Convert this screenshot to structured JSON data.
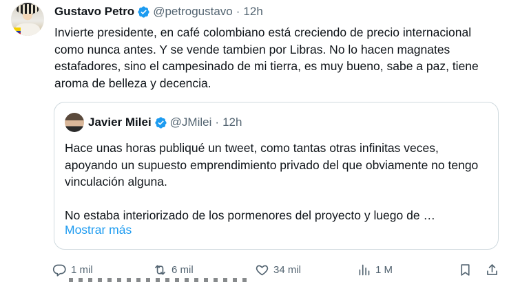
{
  "tweet": {
    "author_name": "Gustavo Petro",
    "handle": "@petrogustavo",
    "separator": "·",
    "time": "12h",
    "text": "Invierte presidente, en café colombiano está creciendo de precio internacional como nunca antes. Y se vende tambien por Libras. No lo hacen magnates estafadores, sino el campesinado de mi tierra, es muy bueno, sabe a paz, tiene aroma de belleza y decencia.",
    "verified_icon": "verified-badge-icon"
  },
  "quote": {
    "author_name": "Javier Milei",
    "handle": "@JMilei",
    "separator": "·",
    "time": "12h",
    "paragraphs": [
      "Hace unas horas publiqué un tweet, como tantas otras infinitas veces, apoyando un supuesto emprendimiento privado del que obviamente no tengo vinculación alguna.",
      "No estaba interiorizado de los pormenores del proyecto y luego de …"
    ],
    "show_more": "Mostrar más"
  },
  "actions": {
    "reply_count": "1 mil",
    "repost_count": "6 mil",
    "like_count": "34 mil",
    "views_count": "1 M"
  },
  "colors": {
    "accent": "#1d9bf0",
    "verified": "#1d9bf0",
    "muted": "#536471",
    "border": "#cfd9de"
  }
}
